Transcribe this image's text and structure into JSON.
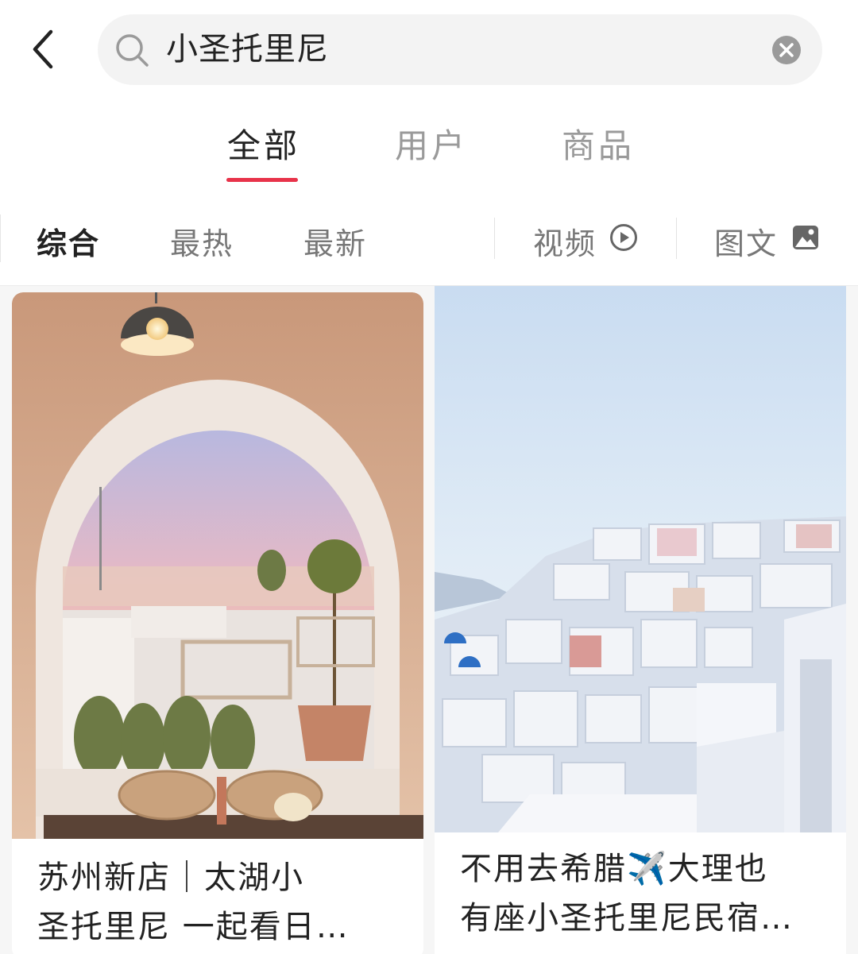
{
  "search": {
    "query": "小圣托里尼",
    "back_icon": "chevron-left-icon",
    "search_icon": "search-icon",
    "clear_icon": "clear-icon"
  },
  "main_tabs": [
    {
      "label": "全部",
      "active": true
    },
    {
      "label": "用户",
      "active": false
    },
    {
      "label": "商品",
      "active": false
    }
  ],
  "filters": {
    "sort": [
      {
        "label": "综合",
        "active": true
      },
      {
        "label": "最热",
        "active": false
      },
      {
        "label": "最新",
        "active": false
      }
    ],
    "video_label": "视频",
    "video_icon": "play-circle-icon",
    "image_text_label": "图文",
    "image_icon": "image-icon"
  },
  "colors": {
    "accent": "#e8334a",
    "search_bg": "#f3f3f3",
    "inactive_text": "#9a9a9a"
  },
  "cards": [
    {
      "title_line1": "苏州新店｜太湖小",
      "title_line2": "圣托里尼 一起看日…",
      "image": "arched-window-terrace-sunset-photo"
    },
    {
      "title_line1": "不用去希腊✈️大理也",
      "title_line2": "有座小圣托里尼民宿…",
      "image": "white-hillside-village-photo"
    }
  ]
}
